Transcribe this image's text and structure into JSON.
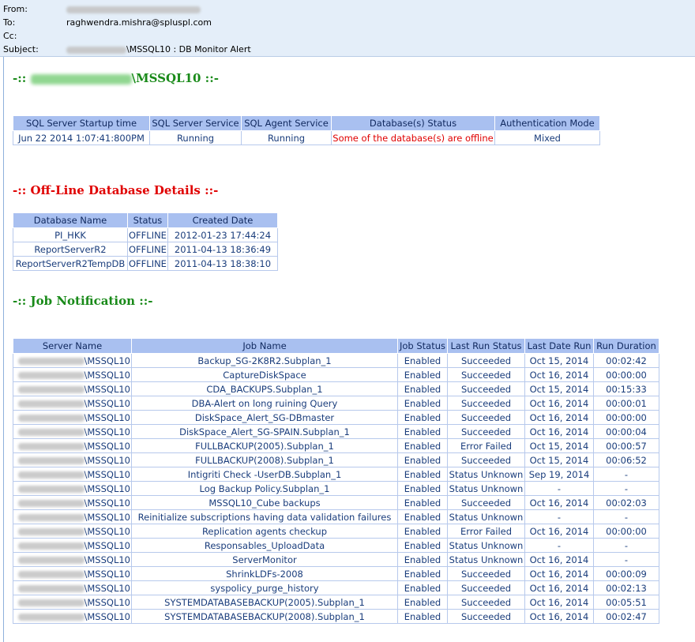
{
  "email": {
    "from_label": "From:",
    "to_label": "To:",
    "to_value": "raghwendra.mishra@spluspl.com",
    "cc_label": "Cc:",
    "subject_label": "Subject:",
    "subject_suffix": "\\MSSQL10 : DB Monitor Alert"
  },
  "server_heading": {
    "prefix": "-:: ",
    "instance": "\\MSSQL10",
    "suffix": " ::-"
  },
  "status_table": {
    "headers": [
      "SQL Server Startup time",
      "SQL Server Service",
      "SQL Agent Service",
      "Database(s) Status",
      "Authentication Mode"
    ],
    "row": [
      "Jun 22 2014 1:07:41:800PM",
      "Running",
      "Running",
      "Some of the database(s) are offline",
      "Mixed"
    ]
  },
  "offline_heading": "-:: Off-Line Database Details ::-",
  "offline_table": {
    "headers": [
      "Database Name",
      "Status",
      "Created Date"
    ],
    "rows": [
      [
        "PI_HKK",
        "OFFLINE",
        "2012-01-23 17:44:24"
      ],
      [
        "ReportServerR2",
        "OFFLINE",
        "2011-04-13 18:36:49"
      ],
      [
        "ReportServerR2TempDB",
        "OFFLINE",
        "2011-04-13 18:38:10"
      ]
    ]
  },
  "job_heading": "-:: Job Notification ::-",
  "job_table": {
    "headers": [
      "Server Name",
      "Job Name",
      "Job Status",
      "Last Run Status",
      "Last Date Run",
      "Run Duration"
    ],
    "rows": [
      [
        "\\MSSQL10",
        "Backup_SG-2K8R2.Subplan_1",
        "Enabled",
        "Succeeded",
        "Oct 15, 2014",
        "00:02:42"
      ],
      [
        "\\MSSQL10",
        "CaptureDiskSpace",
        "Enabled",
        "Succeeded",
        "Oct 16, 2014",
        "00:00:00"
      ],
      [
        "\\MSSQL10",
        "CDA_BACKUPS.Subplan_1",
        "Enabled",
        "Succeeded",
        "Oct 15, 2014",
        "00:15:33"
      ],
      [
        "\\MSSQL10",
        "DBA-Alert on long ruining Query",
        "Enabled",
        "Succeeded",
        "Oct 16, 2014",
        "00:00:01"
      ],
      [
        "\\MSSQL10",
        "DiskSpace_Alert_SG-DBmaster",
        "Enabled",
        "Succeeded",
        "Oct 16, 2014",
        "00:00:00"
      ],
      [
        "\\MSSQL10",
        "DiskSpace_Alert_SG-SPAIN.Subplan_1",
        "Enabled",
        "Succeeded",
        "Oct 16, 2014",
        "00:00:04"
      ],
      [
        "\\MSSQL10",
        "FULLBACKUP(2005).Subplan_1",
        "Enabled",
        "Error Failed",
        "Oct 15, 2014",
        "00:00:57"
      ],
      [
        "\\MSSQL10",
        "FULLBACKUP(2008).Subplan_1",
        "Enabled",
        "Succeeded",
        "Oct 15, 2014",
        "00:06:52"
      ],
      [
        "\\MSSQL10",
        "Intigriti Check -UserDB.Subplan_1",
        "Enabled",
        "Status Unknown",
        "Sep 19, 2014",
        "-"
      ],
      [
        "\\MSSQL10",
        "Log Backup Policy.Subplan_1",
        "Enabled",
        "Status Unknown",
        "-",
        "-"
      ],
      [
        "\\MSSQL10",
        "MSSQL10_Cube backups",
        "Enabled",
        "Succeeded",
        "Oct 16, 2014",
        "00:02:03"
      ],
      [
        "\\MSSQL10",
        "Reinitialize subscriptions having data validation failures",
        "Enabled",
        "Status Unknown",
        "-",
        "-"
      ],
      [
        "\\MSSQL10",
        "Replication agents checkup",
        "Enabled",
        "Error Failed",
        "Oct 16, 2014",
        "00:00:00"
      ],
      [
        "\\MSSQL10",
        "Responsables_UploadData",
        "Enabled",
        "Status Unknown",
        "-",
        "-"
      ],
      [
        "\\MSSQL10",
        "ServerMonitor",
        "Enabled",
        "Status Unknown",
        "Oct 16, 2014",
        "-"
      ],
      [
        "\\MSSQL10",
        "ShrinkLDFs-2008",
        "Enabled",
        "Succeeded",
        "Oct 16, 2014",
        "00:00:09"
      ],
      [
        "\\MSSQL10",
        "syspolicy_purge_history",
        "Enabled",
        "Succeeded",
        "Oct 16, 2014",
        "00:02:13"
      ],
      [
        "\\MSSQL10",
        "SYSTEMDATABASEBACKUP(2005).Subplan_1",
        "Enabled",
        "Succeeded",
        "Oct 16, 2014",
        "00:05:51"
      ],
      [
        "\\MSSQL10",
        "SYSTEMDATABASEBACKUP(2008).Subplan_1",
        "Enabled",
        "Succeeded",
        "Oct 16, 2014",
        "00:02:47"
      ]
    ]
  }
}
